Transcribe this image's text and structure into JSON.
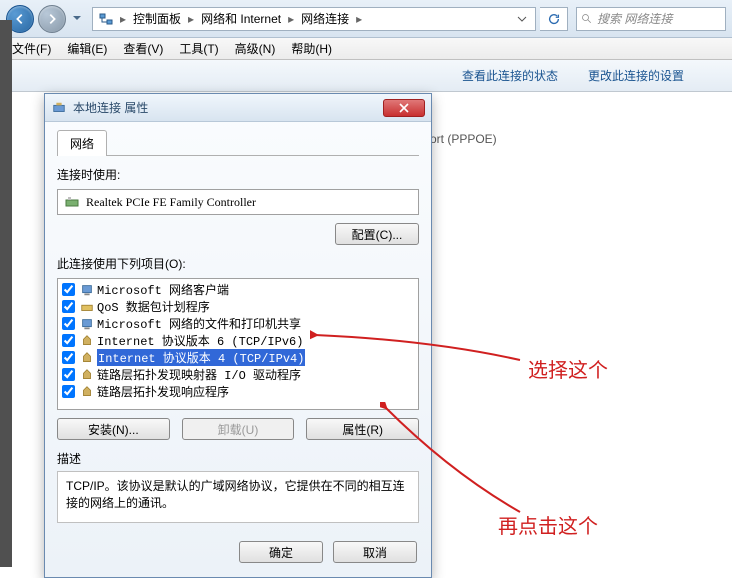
{
  "breadcrumb": {
    "segments": [
      "控制面板",
      "网络和 Internet",
      "网络连接"
    ]
  },
  "search_placeholder": "搜索 网络连接",
  "menubar": {
    "file": "文件(F)",
    "edit": "编辑(E)",
    "view": "查看(V)",
    "tools": "工具(T)",
    "advanced": "高级(N)",
    "help": "帮助(H)"
  },
  "toolbar": {
    "view_status": "查看此连接的状态",
    "change_settings": "更改此连接的设置"
  },
  "content": {
    "pppoe_label": "ort (PPPOE)"
  },
  "dialog": {
    "title": "本地连接 属性",
    "tab_network": "网络",
    "connect_using_label": "连接时使用:",
    "adapter_name": "Realtek PCIe FE Family Controller",
    "configure_btn": "配置(C)...",
    "items_label": "此连接使用下列项目(O):",
    "items": [
      {
        "checked": true,
        "label": "Microsoft 网络客户端"
      },
      {
        "checked": true,
        "label": "QoS 数据包计划程序"
      },
      {
        "checked": true,
        "label": "Microsoft 网络的文件和打印机共享"
      },
      {
        "checked": true,
        "label": "Internet 协议版本 6 (TCP/IPv6)"
      },
      {
        "checked": true,
        "label": "Internet 协议版本 4 (TCP/IPv4)",
        "selected": true
      },
      {
        "checked": true,
        "label": "链路层拓扑发现映射器 I/O 驱动程序"
      },
      {
        "checked": true,
        "label": "链路层拓扑发现响应程序"
      }
    ],
    "install_btn": "安装(N)...",
    "uninstall_btn": "卸载(U)",
    "properties_btn": "属性(R)",
    "desc_label": "描述",
    "desc_text": "TCP/IP。该协议是默认的广域网络协议，它提供在不同的相互连接的网络上的通讯。",
    "ok_btn": "确定",
    "cancel_btn": "取消"
  },
  "annotations": {
    "select_this": "选择这个",
    "then_click": "再点击这个"
  }
}
